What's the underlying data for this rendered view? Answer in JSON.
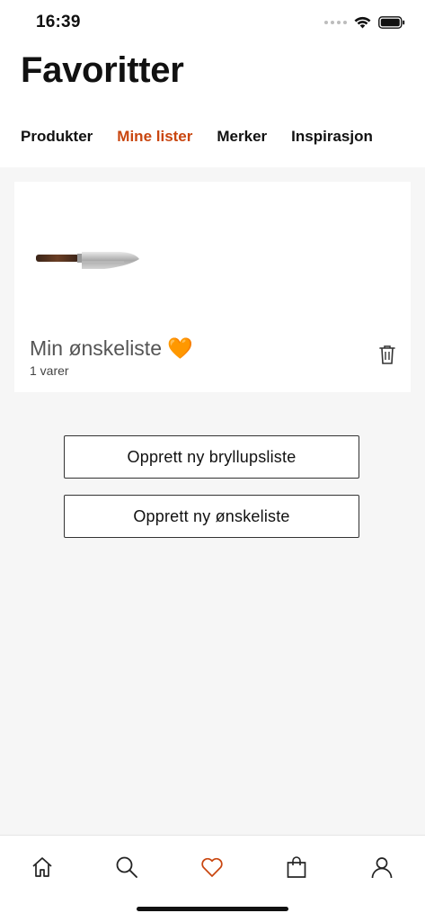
{
  "status": {
    "time": "16:39"
  },
  "header": {
    "title": "Favoritter"
  },
  "tabs": [
    {
      "label": "Produkter",
      "active": false
    },
    {
      "label": "Mine lister",
      "active": true
    },
    {
      "label": "Merker",
      "active": false
    },
    {
      "label": "Inspirasjon",
      "active": false
    }
  ],
  "lists": [
    {
      "name": "Min ønskeliste 🧡",
      "count": "1 varer",
      "thumbnail": "knife-image"
    }
  ],
  "actions": {
    "create_wedding_list": "Opprett ny bryllupsliste",
    "create_wishlist": "Opprett ny ønskeliste"
  },
  "bottom_nav": [
    {
      "icon": "home-icon",
      "active": false
    },
    {
      "icon": "search-icon",
      "active": false
    },
    {
      "icon": "heart-icon",
      "active": true
    },
    {
      "icon": "bag-icon",
      "active": false
    },
    {
      "icon": "profile-icon",
      "active": false
    }
  ],
  "colors": {
    "accent": "#c9460f",
    "background": "#f6f6f6"
  }
}
